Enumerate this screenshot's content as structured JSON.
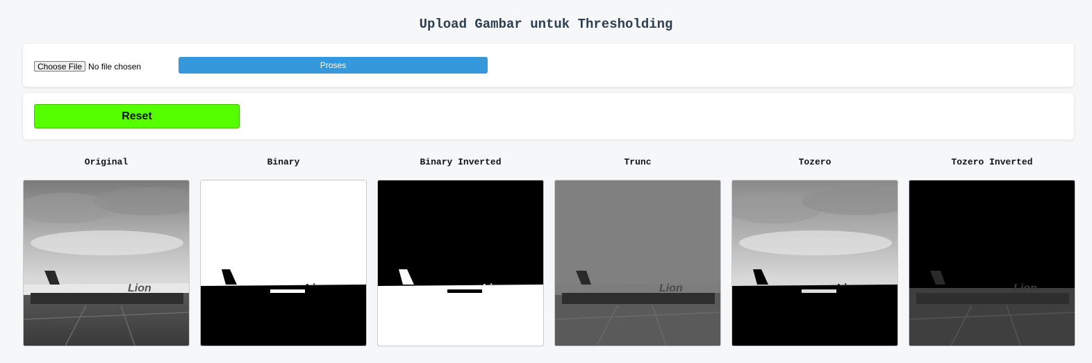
{
  "page_title": "Upload Gambar untuk Thresholding",
  "upload": {
    "choose_file_label": "Choose File",
    "file_status": "No file chosen",
    "process_label": "Proses"
  },
  "reset": {
    "label": "Reset"
  },
  "colors": {
    "process_button": "#3498db",
    "reset_button": "#55ff00",
    "background": "#f6f7f9"
  },
  "results": [
    {
      "label": "Original",
      "style": "original"
    },
    {
      "label": "Binary",
      "style": "binary"
    },
    {
      "label": "Binary Inverted",
      "style": "binary-inverted"
    },
    {
      "label": "Trunc",
      "style": "trunc"
    },
    {
      "label": "Tozero",
      "style": "tozero"
    },
    {
      "label": "Tozero Inverted",
      "style": "tozero-inverted"
    }
  ],
  "plane_livery_text": "Lion"
}
